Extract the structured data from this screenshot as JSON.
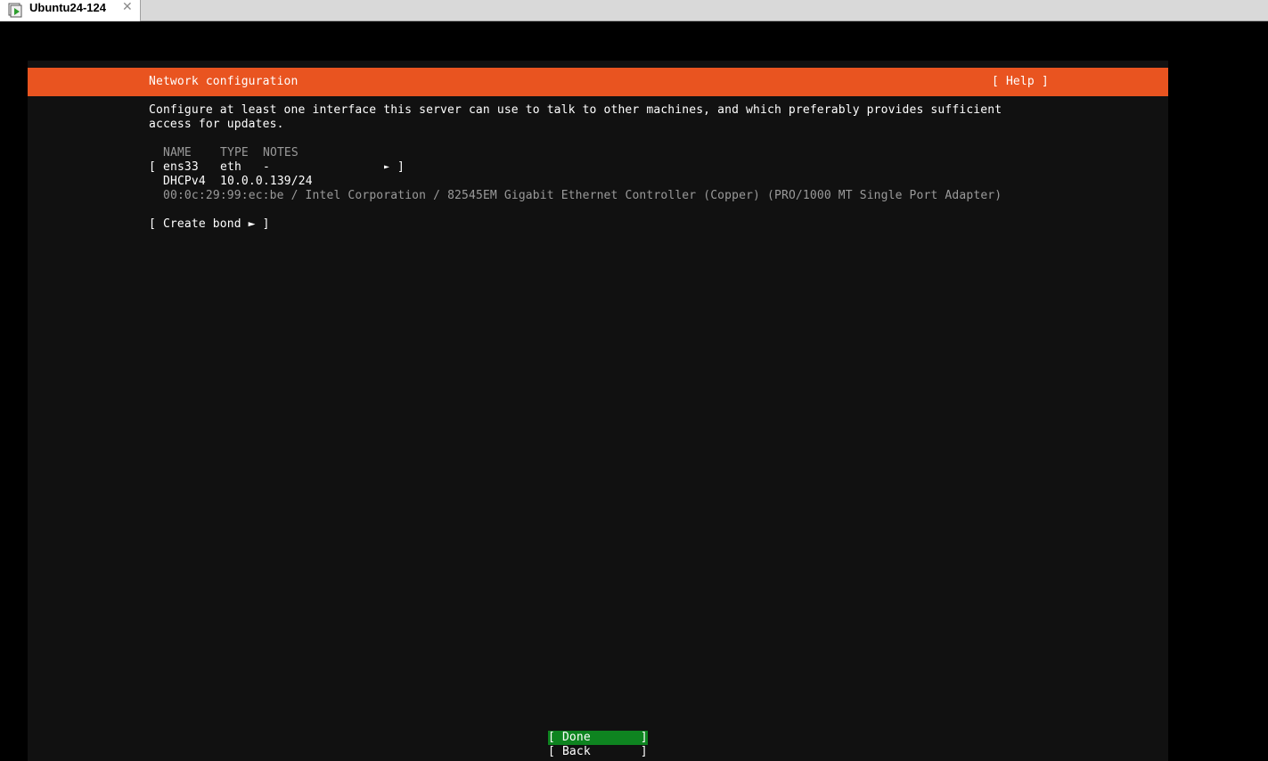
{
  "window": {
    "tab_title": "Ubuntu24-124",
    "close_glyph": "✕"
  },
  "header": {
    "title": "Network configuration",
    "help": "[ Help ]"
  },
  "intro": {
    "line1": "Configure at least one interface this server can use to talk to other machines, and which preferably provides sufficient",
    "line2": "access for updates."
  },
  "table": {
    "columns": [
      "NAME",
      "TYPE",
      "NOTES"
    ],
    "interfaces": [
      {
        "open_bracket": "[",
        "name": "ens33",
        "type": "eth",
        "notes": "-",
        "arrow": "►",
        "close_bracket": "]",
        "address_method": "DHCPv4",
        "address": "10.0.0.139/24",
        "hardware": "00:0c:29:99:ec:be / Intel Corporation / 82545EM Gigabit Ethernet Controller (Copper) (PRO/1000 MT Single Port Adapter)"
      }
    ]
  },
  "create_bond": "[ Create bond ► ]",
  "buttons": {
    "done": "[ Done       ]",
    "back": "[ Back       ]"
  },
  "colors": {
    "accent": "#e95420",
    "done_bg": "#0e8420",
    "screen_bg": "#111111"
  }
}
